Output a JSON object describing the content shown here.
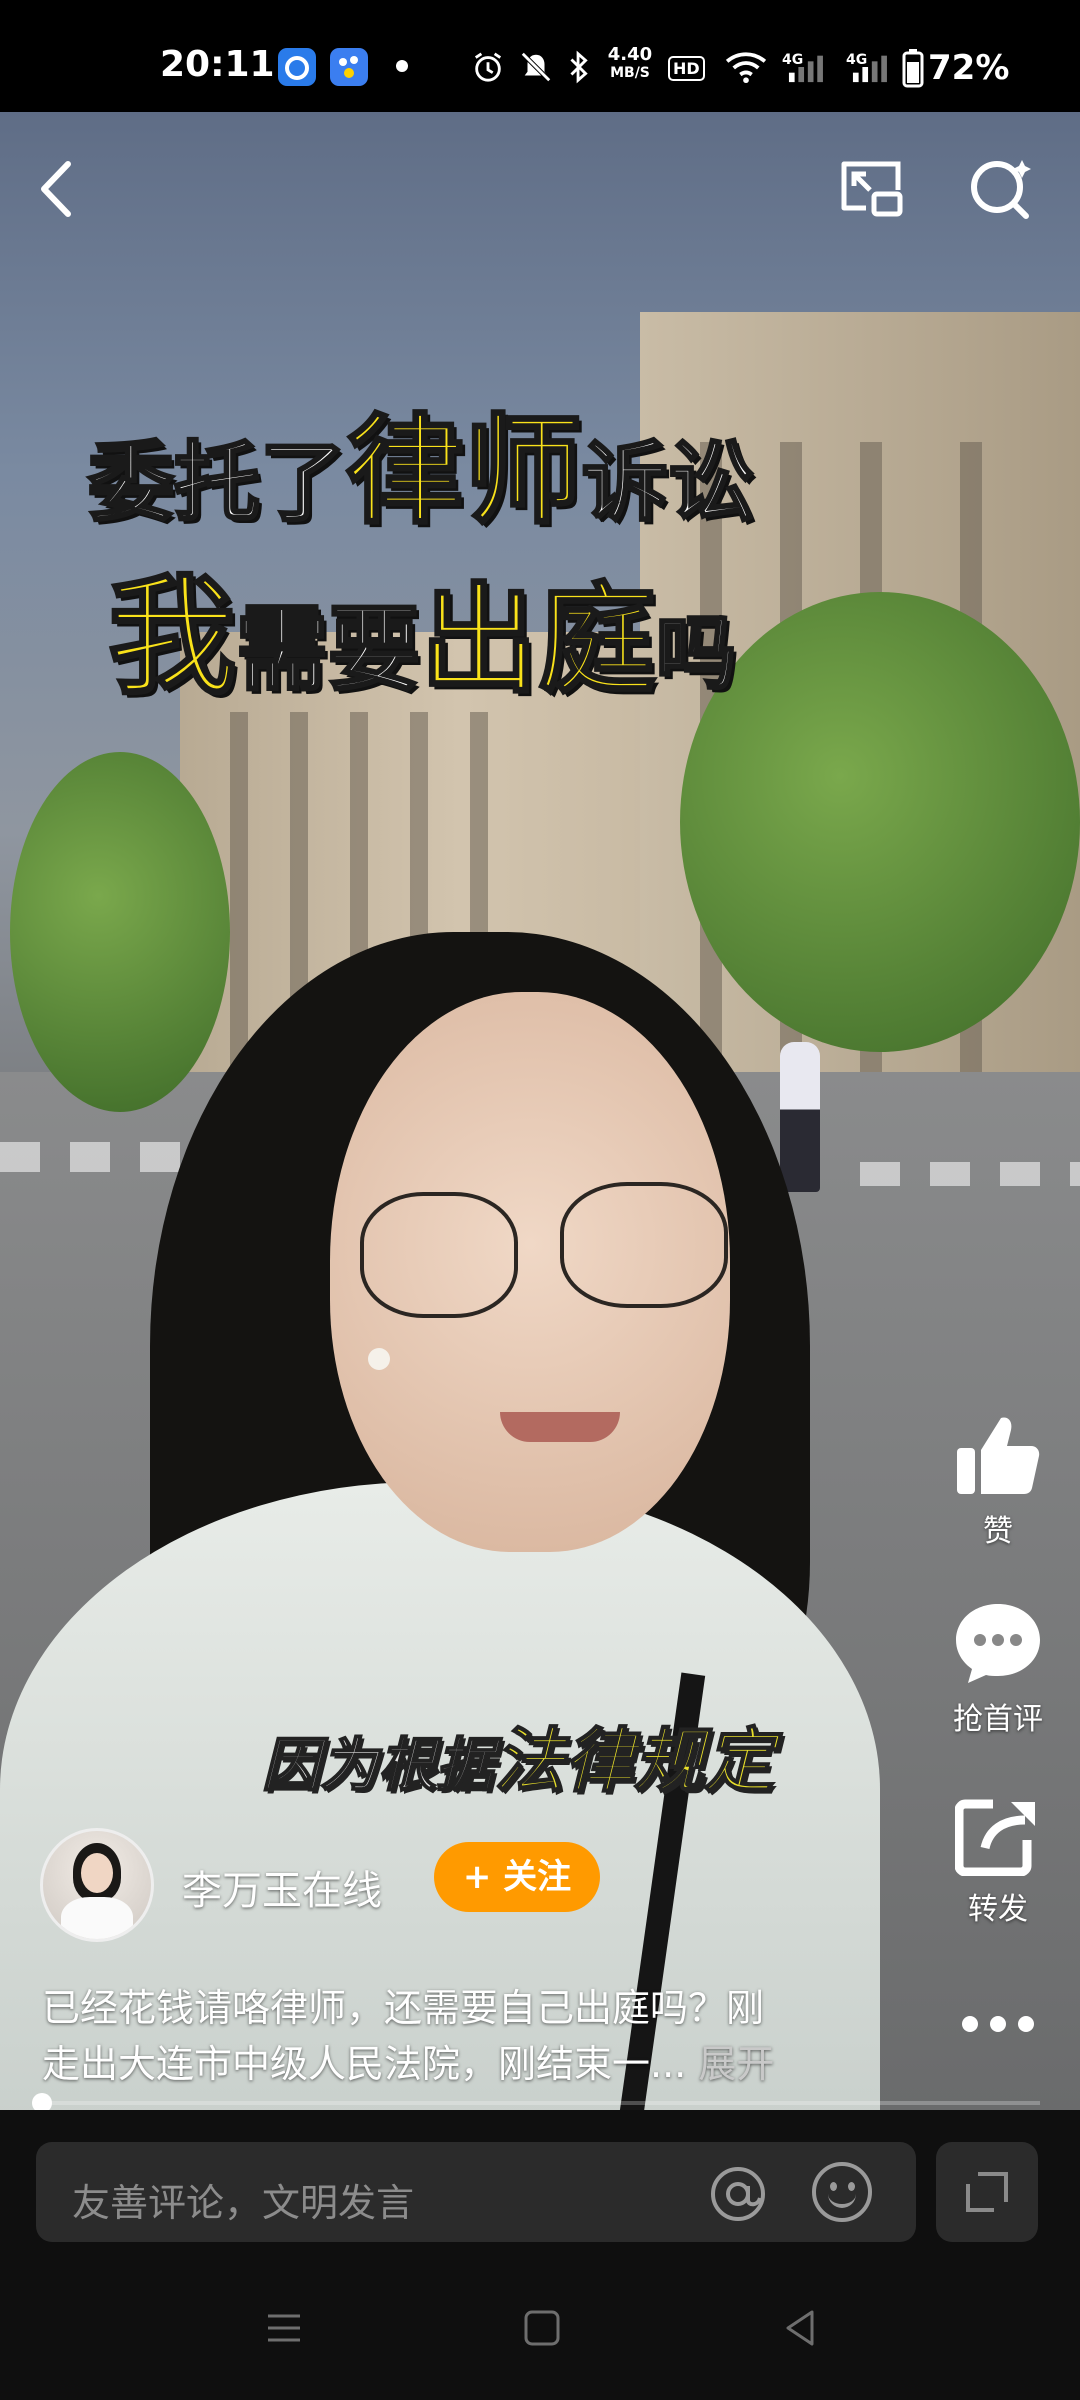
{
  "status_bar": {
    "time": "20:11",
    "net_speed_value": "4.40",
    "net_speed_unit": "MB/S",
    "hd_badge": "HD",
    "signal_1": "4G",
    "signal_2": "4G",
    "battery": "72%",
    "icons": [
      "app-icon-1",
      "app-icon-2",
      "dot-icon",
      "alarm-icon",
      "mute-icon",
      "bluetooth-icon",
      "wifi-icon",
      "signal-icon",
      "battery-icon"
    ]
  },
  "top_bar": {
    "icons": [
      "back-icon",
      "mini-window-icon",
      "search-icon"
    ]
  },
  "video": {
    "headline_line1": {
      "white1": "委托了",
      "yellow": "律师",
      "white2": "诉讼"
    },
    "headline_line2": {
      "yellow1": "我",
      "white1": "需要",
      "yellow2": "出庭",
      "white2": "吗"
    },
    "subtitle": {
      "white": "因为根据",
      "yellow": "法律规定"
    }
  },
  "actions": {
    "like_label": "赞",
    "comment_label": "抢首评",
    "share_label": "转发"
  },
  "author": {
    "name": "李万玉在线",
    "follow_label": "+ 关注"
  },
  "description": {
    "line1": "已经花钱请咯律师，还需要自己出庭吗？刚",
    "line2": "走出大连市中级人民法院，刚结束一...",
    "more": "展开"
  },
  "progress": {
    "played_fraction": 0.01
  },
  "comment_bar": {
    "placeholder": "友善评论，文明发言"
  },
  "colors": {
    "follow_button": "#ff9a00",
    "headline_yellow": "#f9e21a",
    "subtitle_yellow": "#e8df2a"
  }
}
